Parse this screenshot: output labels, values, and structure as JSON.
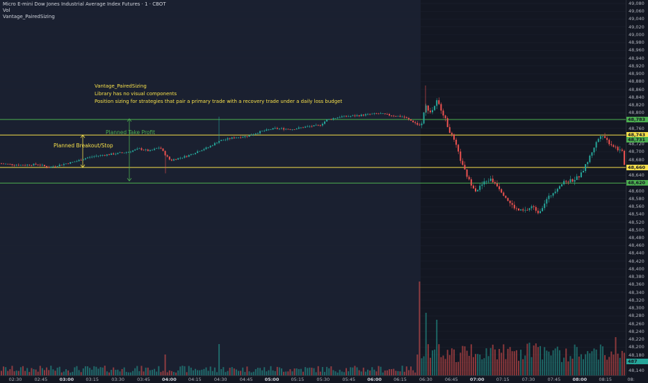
{
  "legend": {
    "title": "Micro E-mini Dow Jones Industrial Average Index Futures · 1 · CBOT",
    "vol": "Vol",
    "indicator": "Vantage_PairedSizing"
  },
  "notes": {
    "name": "Vantage_PairedSizing",
    "line1": "Library has no visual components",
    "line2": "Position sizing for strategies that pair a primary trade with a recovery trade under a daily loss budget"
  },
  "drawings": {
    "take_profit_label": "Planned Take Profit",
    "breakout_label": "Planned Breakout/Stop"
  },
  "colors": {
    "background": "#131722",
    "session_shade": "#1a2030",
    "up": "#26a69a",
    "down": "#ef5350",
    "yellow_line": "#f7e04b",
    "green_line": "#4caf50"
  },
  "price_tags": [
    {
      "label": "48,783",
      "price": 48783,
      "color": "#4caf50"
    },
    {
      "label": "48,743",
      "price": 48743,
      "color": "#f7e04b"
    },
    {
      "label": "48,731",
      "price": 48731,
      "color": "#4caf50"
    },
    {
      "label": "48,660",
      "price": 48660,
      "color": "#f7e04b"
    },
    {
      "label": "48,620",
      "price": 48620,
      "color": "#4caf50"
    }
  ],
  "volume_tag": {
    "label": "487"
  },
  "chart_data": {
    "type": "candlestick",
    "y_ticks": [
      "49,080",
      "49,060",
      "49,040",
      "49,020",
      "49,000",
      "48,980",
      "48,960",
      "48,940",
      "48,920",
      "48,900",
      "48,880",
      "48,860",
      "48,840",
      "48,820",
      "48,800",
      "48,780",
      "48,760",
      "48,740",
      "48,720",
      "48,700",
      "48,680",
      "48,660",
      "48,640",
      "48,620",
      "48,600",
      "48,580",
      "48,560",
      "48,540",
      "48,520",
      "48,500",
      "48,480",
      "48,460",
      "48,440",
      "48,420",
      "48,400",
      "48,380",
      "48,360",
      "48,340",
      "48,320",
      "48,300",
      "48,280",
      "48,260",
      "48,240",
      "48,220",
      "48,200",
      "48,180",
      "48,160",
      "48,140"
    ],
    "ylim": [
      48140,
      49080
    ],
    "x_ticks": [
      {
        "label": "02:30",
        "bold": false
      },
      {
        "label": "02:45",
        "bold": false
      },
      {
        "label": "03:00",
        "bold": true
      },
      {
        "label": "03:15",
        "bold": false
      },
      {
        "label": "03:30",
        "bold": false
      },
      {
        "label": "03:45",
        "bold": false
      },
      {
        "label": "04:00",
        "bold": true
      },
      {
        "label": "04:15",
        "bold": false
      },
      {
        "label": "04:30",
        "bold": false
      },
      {
        "label": "04:45",
        "bold": false
      },
      {
        "label": "05:00",
        "bold": true
      },
      {
        "label": "05:15",
        "bold": false
      },
      {
        "label": "05:30",
        "bold": false
      },
      {
        "label": "05:45",
        "bold": false
      },
      {
        "label": "06:00",
        "bold": true
      },
      {
        "label": "06:15",
        "bold": false
      },
      {
        "label": "06:30",
        "bold": false
      },
      {
        "label": "06:45",
        "bold": false
      },
      {
        "label": "07:00",
        "bold": true
      },
      {
        "label": "07:15",
        "bold": false
      },
      {
        "label": "07:30",
        "bold": false
      },
      {
        "label": "07:45",
        "bold": false
      },
      {
        "label": "08:00",
        "bold": true
      },
      {
        "label": "08:15",
        "bold": false
      },
      {
        "label": "08:",
        "bold": false
      }
    ],
    "horizontal_levels": [
      {
        "price": 48783,
        "color": "green"
      },
      {
        "price": 48743,
        "color": "yellow"
      },
      {
        "price": 48660,
        "color": "yellow"
      },
      {
        "price": 48620,
        "color": "green"
      }
    ],
    "price_path": [
      [
        0,
        48670
      ],
      [
        30,
        48666
      ],
      [
        55,
        48668
      ],
      [
        70,
        48660
      ],
      [
        90,
        48668
      ],
      [
        110,
        48676
      ],
      [
        125,
        48685
      ],
      [
        140,
        48690
      ],
      [
        165,
        48695
      ],
      [
        185,
        48700
      ],
      [
        200,
        48708
      ],
      [
        215,
        48702
      ],
      [
        230,
        48712
      ],
      [
        238,
        48692
      ],
      [
        245,
        48678
      ],
      [
        255,
        48683
      ],
      [
        270,
        48690
      ],
      [
        285,
        48702
      ],
      [
        300,
        48712
      ],
      [
        315,
        48728
      ],
      [
        335,
        48736
      ],
      [
        355,
        48740
      ],
      [
        375,
        48752
      ],
      [
        395,
        48760
      ],
      [
        420,
        48758
      ],
      [
        440,
        48764
      ],
      [
        460,
        48768
      ],
      [
        470,
        48782
      ],
      [
        490,
        48790
      ],
      [
        510,
        48792
      ],
      [
        530,
        48796
      ],
      [
        545,
        48798
      ],
      [
        560,
        48794
      ],
      [
        580,
        48790
      ],
      [
        595,
        48776
      ],
      [
        605,
        48765
      ],
      [
        612,
        48818
      ],
      [
        620,
        48800
      ],
      [
        628,
        48830
      ],
      [
        636,
        48805
      ],
      [
        645,
        48760
      ],
      [
        655,
        48720
      ],
      [
        665,
        48665
      ],
      [
        675,
        48625
      ],
      [
        685,
        48600
      ],
      [
        695,
        48620
      ],
      [
        705,
        48630
      ],
      [
        715,
        48615
      ],
      [
        725,
        48590
      ],
      [
        735,
        48565
      ],
      [
        745,
        48550
      ],
      [
        755,
        48548
      ],
      [
        765,
        48560
      ],
      [
        775,
        48545
      ],
      [
        785,
        48575
      ],
      [
        795,
        48595
      ],
      [
        805,
        48615
      ],
      [
        815,
        48625
      ],
      [
        825,
        48628
      ],
      [
        835,
        48640
      ],
      [
        845,
        48675
      ],
      [
        855,
        48715
      ],
      [
        865,
        48748
      ],
      [
        875,
        48725
      ],
      [
        888,
        48708
      ],
      [
        895,
        48698
      ],
      [
        899,
        48660
      ]
    ],
    "volume_spikes": [
      [
        238,
        30
      ],
      [
        315,
        45
      ],
      [
        604,
        135
      ],
      [
        612,
        90
      ],
      [
        628,
        80
      ],
      [
        885,
        55
      ]
    ]
  }
}
